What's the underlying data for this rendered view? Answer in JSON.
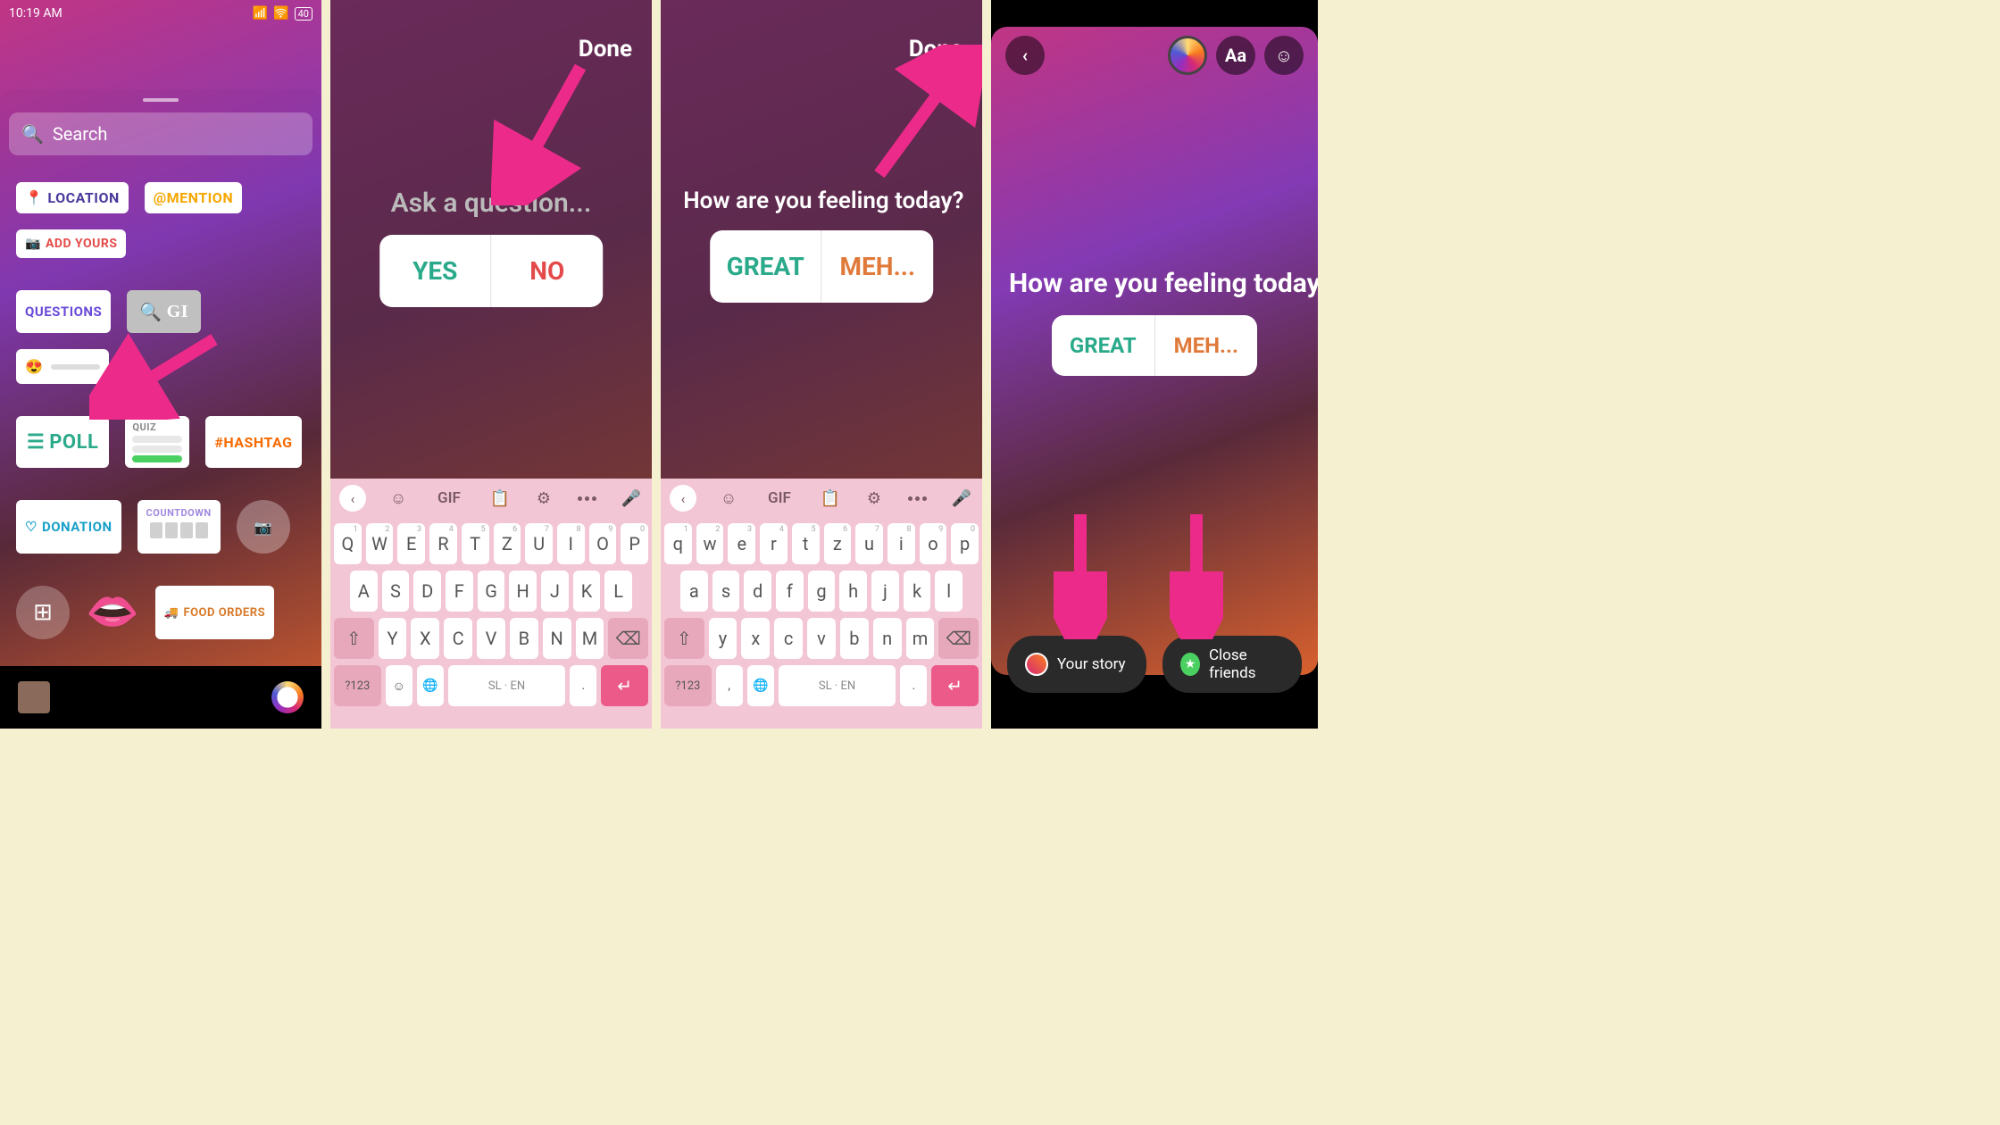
{
  "status": {
    "time": "10:19 AM",
    "battery": "40"
  },
  "s1": {
    "search_placeholder": "Search",
    "stickers": {
      "location": "LOCATION",
      "mention": "@MENTION",
      "addyours": "ADD YOURS",
      "questions": "QUESTIONS",
      "gif": "GI",
      "poll": "POLL",
      "quiz": "QUIZ",
      "hashtag": "#HASHTAG",
      "donation": "DONATION",
      "countdown": "COUNTDOWN",
      "foodorders": "FOOD ORDERS"
    }
  },
  "s2": {
    "done": "Done",
    "question": "Ask a question...",
    "opt1": "YES",
    "opt2": "NO"
  },
  "s3": {
    "done": "Done",
    "question": "How are you feeling today?",
    "opt1": "GREAT",
    "opt2": "MEH..."
  },
  "s4": {
    "question": "How are you feeling today?",
    "opt1": "GREAT",
    "opt2": "MEH...",
    "your_story": "Your story",
    "close_friends": "Close friends",
    "aa": "Aa"
  },
  "kb": {
    "gif": "GIF",
    "row1_upper": [
      "Q",
      "W",
      "E",
      "R",
      "T",
      "Z",
      "U",
      "I",
      "O",
      "P"
    ],
    "row1_lower": [
      "q",
      "w",
      "e",
      "r",
      "t",
      "z",
      "u",
      "i",
      "o",
      "p"
    ],
    "sup": [
      "1",
      "2",
      "3",
      "4",
      "5",
      "6",
      "7",
      "8",
      "9",
      "0"
    ],
    "row2_upper": [
      "A",
      "S",
      "D",
      "F",
      "G",
      "H",
      "J",
      "K",
      "L"
    ],
    "row2_lower": [
      "a",
      "s",
      "d",
      "f",
      "g",
      "h",
      "j",
      "k",
      "l"
    ],
    "row3_upper": [
      "Y",
      "X",
      "C",
      "V",
      "B",
      "N",
      "M"
    ],
    "row3_lower": [
      "y",
      "x",
      "c",
      "v",
      "b",
      "n",
      "m"
    ],
    "numkey": "?123",
    "lang": "SL · EN",
    "comma": ",",
    "period": "."
  }
}
